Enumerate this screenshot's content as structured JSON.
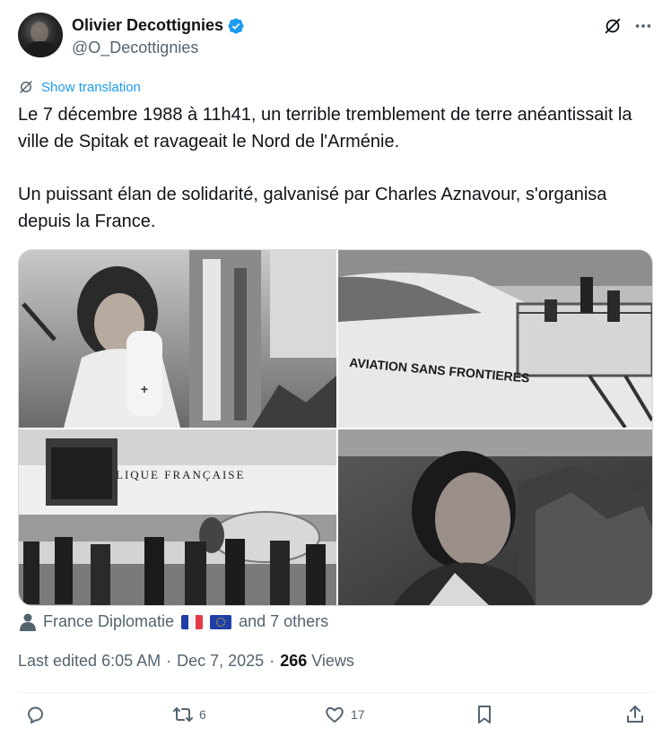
{
  "author": {
    "display_name": "Olivier Decottignies",
    "handle": "@O_Decottignies",
    "verified": true
  },
  "translate": {
    "label": "Show translation"
  },
  "tweet": {
    "paragraphs": [
      "Le 7 décembre 1988 à 11h41, un terrible tremblement de terre anéantissait la ville de Spitak et ravageait le Nord de l'Arménie.",
      "Un puissant élan de solidarité, galvanisé par Charles Aznavour, s'organisa depuis la France."
    ]
  },
  "media": {
    "photos": [
      {
        "name": "girl-in-rubble",
        "caption_text": ""
      },
      {
        "name": "aircraft-boarding",
        "caption_text": "AVIATION SANS FRONTIERES"
      },
      {
        "name": "aircraft-unloading",
        "caption_text": "LIQUE FRANÇAISE"
      },
      {
        "name": "aznavour-portrait",
        "caption_text": ""
      }
    ]
  },
  "tagged": {
    "primary": "France Diplomatie",
    "others": "and 7 others"
  },
  "meta": {
    "edited": "Last edited 6:05 AM",
    "date": "Dec 7, 2025",
    "views_count": "266",
    "views_label": "Views"
  },
  "actions": {
    "replies": "",
    "retweets": "6",
    "likes": "17"
  },
  "colors": {
    "link": "#1d9bf0",
    "secondary_text": "#536471",
    "primary_text": "#0f1419",
    "divider": "#eff3f4"
  }
}
